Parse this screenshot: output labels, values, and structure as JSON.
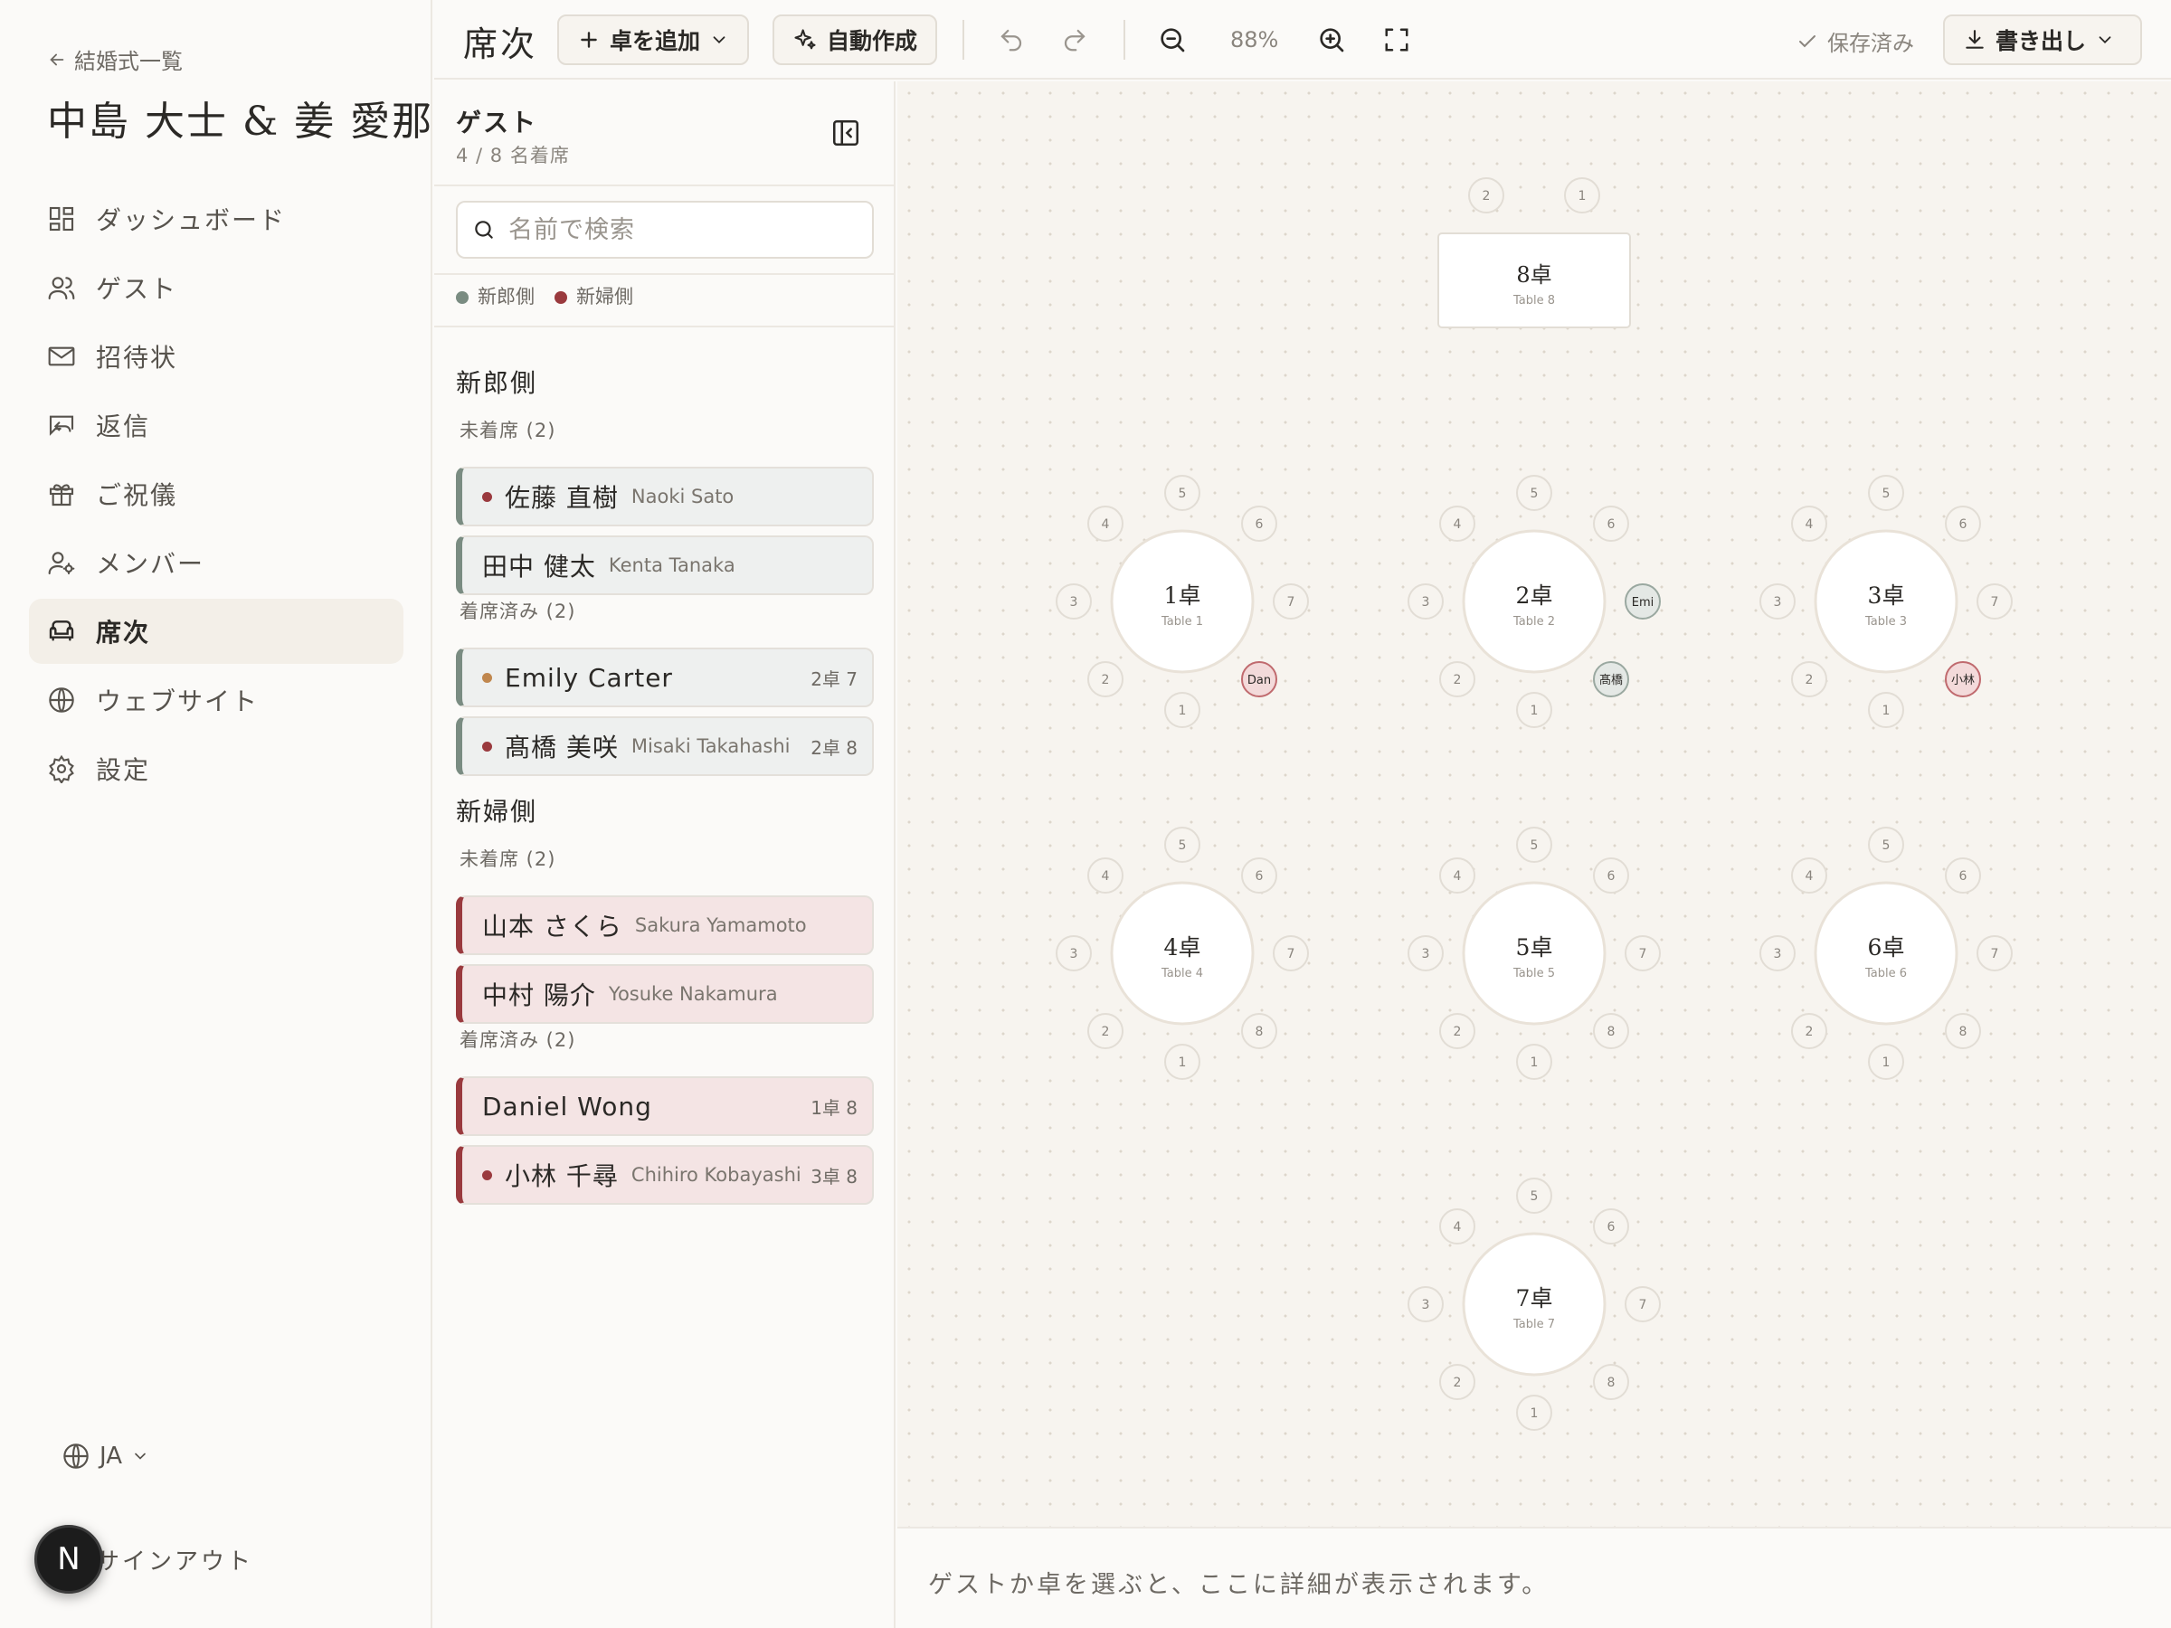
{
  "sidebar": {
    "back_label": "結婚式一覧",
    "couple_names": "中島 大士 & 姜 愛那",
    "items": [
      {
        "label": "ダッシュボード",
        "icon": "dashboard-icon",
        "active": false
      },
      {
        "label": "ゲスト",
        "icon": "users-icon",
        "active": false
      },
      {
        "label": "招待状",
        "icon": "mail-icon",
        "active": false
      },
      {
        "label": "返信",
        "icon": "reply-icon",
        "active": false
      },
      {
        "label": "ご祝儀",
        "icon": "gift-icon",
        "active": false
      },
      {
        "label": "メンバー",
        "icon": "user-gear-icon",
        "active": false
      },
      {
        "label": "席次",
        "icon": "sofa-icon",
        "active": true
      },
      {
        "label": "ウェブサイト",
        "icon": "globe-icon",
        "active": false
      },
      {
        "label": "設定",
        "icon": "gear-icon",
        "active": false
      }
    ],
    "language": "JA",
    "signout_label": "サインアウト",
    "avatar_letter": "N"
  },
  "toolbar": {
    "title": "席次",
    "add_table_label": "卓を追加",
    "auto_create_label": "自動作成",
    "zoom_level": "88%",
    "saved_label": "保存済み",
    "export_label": "書き出し"
  },
  "guest_panel": {
    "title": "ゲスト",
    "count": "4 / 8 名着席",
    "search_placeholder": "名前で検索",
    "legend": {
      "groom": "新郎側",
      "bride": "新婦側"
    },
    "groups": [
      {
        "title": "新郎側",
        "side": "groom",
        "unseated_label": "未着席 (2)",
        "unseated": [
          {
            "name": "佐藤 直樹",
            "roman": "Naoki Sato",
            "dot": "#9a3a3e"
          },
          {
            "name": "田中 健太",
            "roman": "Kenta Tanaka",
            "dot": ""
          }
        ],
        "seated_label": "着席済み (2)",
        "seated": [
          {
            "name": "Emily Carter",
            "roman": "",
            "seat": "2卓 7",
            "dot": "#c0874e"
          },
          {
            "name": "髙橋 美咲",
            "roman": "Misaki Takahashi",
            "seat": "2卓 8",
            "dot": "#9a3a3e"
          }
        ]
      },
      {
        "title": "新婦側",
        "side": "bride",
        "unseated_label": "未着席 (2)",
        "unseated": [
          {
            "name": "山本 さくら",
            "roman": "Sakura Yamamoto",
            "dot": ""
          },
          {
            "name": "中村 陽介",
            "roman": "Yosuke Nakamura",
            "dot": ""
          }
        ],
        "seated_label": "着席済み (2)",
        "seated": [
          {
            "name": "Daniel Wong",
            "roman": "",
            "seat": "1卓 8",
            "dot": ""
          },
          {
            "name": "小林 千尋",
            "roman": "Chihiro Kobayashi",
            "seat": "3卓 8",
            "dot": "#9a3a3e"
          }
        ]
      }
    ]
  },
  "colors": {
    "groom": "#7a8c82",
    "bride": "#9a3a3e",
    "accent_bg": "#f3efe8"
  },
  "tables": [
    {
      "label": "1卓",
      "sub": "Table 1",
      "shape": "round",
      "occupied": {
        "8": {
          "text": "Dan",
          "side": "bride"
        }
      }
    },
    {
      "label": "2卓",
      "sub": "Table 2",
      "shape": "round",
      "occupied": {
        "7": {
          "text": "Emi",
          "side": "groom"
        },
        "8": {
          "text": "髙橋",
          "side": "groom"
        }
      }
    },
    {
      "label": "3卓",
      "sub": "Table 3",
      "shape": "round",
      "occupied": {
        "8": {
          "text": "小林",
          "side": "bride"
        }
      }
    },
    {
      "label": "4卓",
      "sub": "Table 4",
      "shape": "round",
      "occupied": {}
    },
    {
      "label": "5卓",
      "sub": "Table 5",
      "shape": "round",
      "occupied": {}
    },
    {
      "label": "6卓",
      "sub": "Table 6",
      "shape": "round",
      "occupied": {}
    },
    {
      "label": "7卓",
      "sub": "Table 7",
      "shape": "round",
      "occupied": {}
    },
    {
      "label": "8卓",
      "sub": "Table 8",
      "shape": "rect",
      "seats": [
        "2",
        "1"
      ]
    }
  ],
  "round_seat_labels": [
    "1",
    "2",
    "3",
    "4",
    "5",
    "6",
    "7",
    "8"
  ],
  "detail_hint": "ゲストか卓を選ぶと、ここに詳細が表示されます。"
}
